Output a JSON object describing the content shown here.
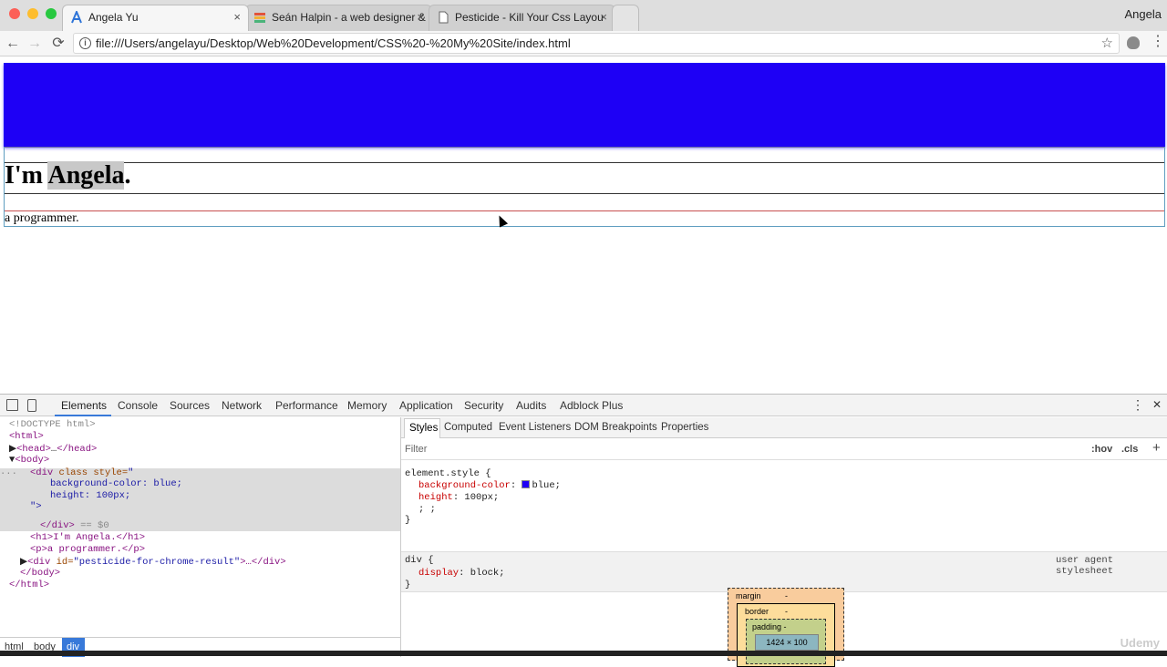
{
  "browser": {
    "tabs": [
      {
        "label": "Angela Yu",
        "active": true
      },
      {
        "label": "Seán Halpin - a web designer &",
        "active": false
      },
      {
        "label": "Pesticide - Kill Your Css Layou",
        "active": false
      }
    ],
    "tab_close": "×",
    "user": "Angela",
    "url": "file:///Users/angelayu/Desktop/Web%20Development/CSS%20-%20My%20Site/index.html",
    "nav": {
      "back": "←",
      "forward": "→",
      "reload": "⟳",
      "star": "☆",
      "menu": "⋮",
      "info": "i"
    }
  },
  "page": {
    "h1_prefix": "I'm ",
    "h1_selected": "Angela",
    "h1_suffix": ".",
    "paragraph": "a programmer.",
    "block_color": "#1e00f5"
  },
  "devtools": {
    "tabs": [
      "Elements",
      "Console",
      "Sources",
      "Network",
      "Performance",
      "Memory",
      "Application",
      "Security",
      "Audits",
      "Adblock Plus"
    ],
    "more": "⋮",
    "close": "✕",
    "dom": {
      "doctype": "<!DOCTYPE html>",
      "html_open": "<html>",
      "head_tag": "<head>",
      "head_collapsed": "…",
      "head_close": "</head>",
      "body_open": "<body>",
      "div_open": "<div",
      "div_attr": "class style=",
      "div_quote": "\"",
      "style_line1": "background-color:  blue;",
      "style_line2": "height:  100px;",
      "style_end": "\">",
      "div_close": "</div>",
      "div_marker": " == $0",
      "h1_line": "<h1>I'm Angela.</h1>",
      "p_line": "<p>a programmer.</p>",
      "pesticide_open": "<div ",
      "pesticide_attr": "id=",
      "pesticide_val": "\"pesticide-for-chrome-result\"",
      "pesticide_end": ">…</div>",
      "body_close": "</body>",
      "html_close": "</html>",
      "ellipsis": "..."
    },
    "breadcrumbs": [
      "html",
      "body",
      "div"
    ],
    "styles_tabs": [
      "Styles",
      "Computed",
      "Event Listeners",
      "DOM Breakpoints",
      "Properties"
    ],
    "filter_placeholder": "Filter",
    "hov": ":hov",
    "cls": ".cls",
    "plus": "+",
    "element_style": {
      "selector": "element.style {",
      "prop1": "background-color",
      "val1": "blue;",
      "prop2": "height",
      "val2": "100px;",
      "blank": "; ;",
      "close": "}"
    },
    "ua_rule": {
      "selector": "div {",
      "source": "user agent stylesheet",
      "prop": "display",
      "val": "block;",
      "close": "}"
    },
    "box_model": {
      "margin": "margin",
      "border": "border",
      "padding": "padding -",
      "dash": "-",
      "content": "1424 × 100"
    }
  },
  "watermark": "Udemy"
}
